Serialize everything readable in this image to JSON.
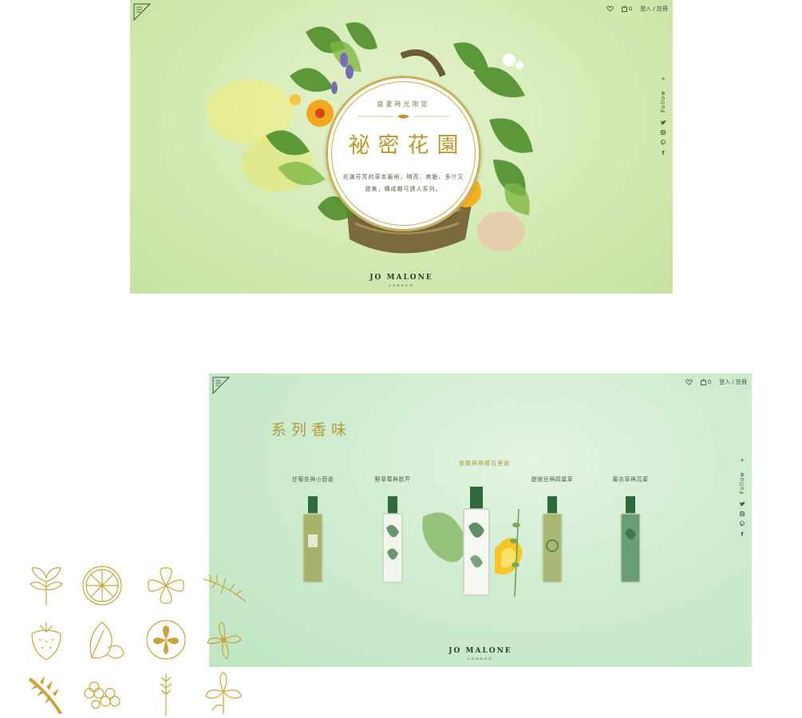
{
  "colors": {
    "gold": "#b8982f",
    "leaf_green": "#4b8a2e",
    "bottle_green": "#2f6b3a",
    "hero_bg": "#d3eab3",
    "collection_bg": "#cfeccf"
  },
  "header": {
    "wishlist_icon": "heart-icon",
    "cart_icon": "bag-icon",
    "cart_count": "0",
    "auth_label": "登入 / 註冊"
  },
  "social": {
    "follow_label": "Follow",
    "plus": "+",
    "facebook": "f",
    "icons": [
      "twitter-icon",
      "instagram-icon",
      "pinterest-icon",
      "facebook-icon"
    ]
  },
  "hero": {
    "subtitle": "盛夏時光限定",
    "title": "祕密花園",
    "description": "充滿芬芳的草本藝術，明亮、爽脆、多汁又甜美，構成趣可誘人系列。"
  },
  "brand": {
    "name": "Jo Malone",
    "city": "London"
  },
  "collection": {
    "heading": "系列香味",
    "featured_label": "黎檬與檸檬百里香",
    "products": [
      {
        "name": "甘菊花與小茴香",
        "liquid": "#a9b26a"
      },
      {
        "name": "野草莓與歐芹",
        "liquid": "#f2f5ee"
      },
      {
        "name": "",
        "liquid": "#f6f7f3"
      },
      {
        "name": "甜豌豆與四葉草",
        "liquid": "#a8b873"
      },
      {
        "name": "薰衣草與芫荽",
        "liquid": "#6a9e74"
      }
    ]
  },
  "icon_grid": [
    "parsley-icon",
    "lemon-slice-icon",
    "clover-icon",
    "thyme-icon",
    "strawberry-icon",
    "spinach-leaf-icon",
    "sweet-pea-icon",
    "lavender-sprig-icon",
    "fern-icon",
    "violet-flowers-icon",
    "wheat-icon",
    "iris-icon"
  ]
}
